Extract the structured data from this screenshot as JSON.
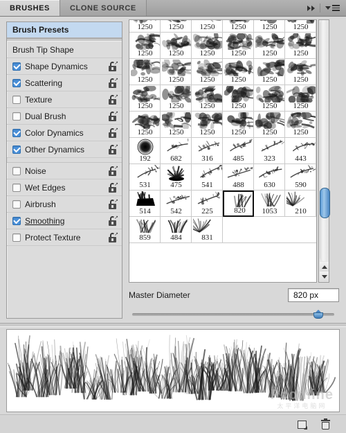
{
  "header": {
    "tabs": [
      {
        "label": "BRUSHES",
        "active": true
      },
      {
        "label": "CLONE SOURCE",
        "active": false
      }
    ],
    "collapse_icon": "double-chevron-right-icon",
    "menu_icon": "panel-menu-icon"
  },
  "sidebar": {
    "preset_label": "Brush Presets",
    "tip_shape_label": "Brush Tip Shape",
    "group1": [
      {
        "label": "Shape Dynamics",
        "checked": true,
        "lock": "lock-open-icon"
      },
      {
        "label": "Scattering",
        "checked": true,
        "lock": "lock-open-icon"
      },
      {
        "label": "Texture",
        "checked": false,
        "lock": "lock-open-icon"
      },
      {
        "label": "Dual Brush",
        "checked": false,
        "lock": "lock-open-icon"
      },
      {
        "label": "Color Dynamics",
        "checked": true,
        "lock": "lock-open-icon"
      },
      {
        "label": "Other Dynamics",
        "checked": true,
        "lock": "lock-open-icon"
      }
    ],
    "group2": [
      {
        "label": "Noise",
        "checked": false,
        "lock": "lock-open-icon"
      },
      {
        "label": "Wet Edges",
        "checked": false,
        "lock": "lock-open-icon"
      },
      {
        "label": "Airbrush",
        "checked": false,
        "lock": "lock-open-icon"
      },
      {
        "label": "Smoothing",
        "checked": true,
        "lock": "lock-open-icon"
      },
      {
        "label": "Protect Texture",
        "checked": false,
        "lock": "lock-open-icon"
      }
    ]
  },
  "brush_grid": {
    "columns": 6,
    "selected_size": "820",
    "cells": [
      {
        "size": "1250",
        "shape": "smoke",
        "partial": true
      },
      {
        "size": "1250",
        "shape": "smoke",
        "partial": true
      },
      {
        "size": "1250",
        "shape": "smoke",
        "partial": true
      },
      {
        "size": "1250",
        "shape": "smoke",
        "partial": true
      },
      {
        "size": "1250",
        "shape": "smoke",
        "partial": true
      },
      {
        "size": "1250",
        "shape": "smoke",
        "partial": true
      },
      {
        "size": "1250",
        "shape": "smoke"
      },
      {
        "size": "1250",
        "shape": "smoke"
      },
      {
        "size": "1250",
        "shape": "smoke"
      },
      {
        "size": "1250",
        "shape": "smoke"
      },
      {
        "size": "1250",
        "shape": "smoke"
      },
      {
        "size": "1250",
        "shape": "smoke"
      },
      {
        "size": "1250",
        "shape": "smoke"
      },
      {
        "size": "1250",
        "shape": "smoke"
      },
      {
        "size": "1250",
        "shape": "smoke"
      },
      {
        "size": "1250",
        "shape": "smoke"
      },
      {
        "size": "1250",
        "shape": "smoke"
      },
      {
        "size": "1250",
        "shape": "smoke"
      },
      {
        "size": "1250",
        "shape": "smoke"
      },
      {
        "size": "1250",
        "shape": "smoke"
      },
      {
        "size": "1250",
        "shape": "smoke"
      },
      {
        "size": "1250",
        "shape": "smoke"
      },
      {
        "size": "1250",
        "shape": "smoke"
      },
      {
        "size": "1250",
        "shape": "smoke"
      },
      {
        "size": "1250",
        "shape": "smoke"
      },
      {
        "size": "1250",
        "shape": "smoke"
      },
      {
        "size": "1250",
        "shape": "smoke"
      },
      {
        "size": "1250",
        "shape": "smoke"
      },
      {
        "size": "1250",
        "shape": "smoke"
      },
      {
        "size": "1250",
        "shape": "smoke"
      },
      {
        "size": "192",
        "shape": "soft-round"
      },
      {
        "size": "682",
        "shape": "branch"
      },
      {
        "size": "316",
        "shape": "branch"
      },
      {
        "size": "485",
        "shape": "branch"
      },
      {
        "size": "323",
        "shape": "branch"
      },
      {
        "size": "443",
        "shape": "branch"
      },
      {
        "size": "531",
        "shape": "branch"
      },
      {
        "size": "475",
        "shape": "burst"
      },
      {
        "size": "541",
        "shape": "branch"
      },
      {
        "size": "488",
        "shape": "branch"
      },
      {
        "size": "630",
        "shape": "branch"
      },
      {
        "size": "590",
        "shape": "branch"
      },
      {
        "size": "514",
        "shape": "bush-solid"
      },
      {
        "size": "542",
        "shape": "branch"
      },
      {
        "size": "225",
        "shape": "branch"
      },
      {
        "size": "820",
        "shape": "grass",
        "selected": true
      },
      {
        "size": "1053",
        "shape": "grass"
      },
      {
        "size": "210",
        "shape": "grass-fan"
      },
      {
        "size": "859",
        "shape": "grass"
      },
      {
        "size": "484",
        "shape": "grass"
      },
      {
        "size": "831",
        "shape": "grass-fan"
      },
      {
        "size": "",
        "shape": "",
        "blank": true
      },
      {
        "size": "",
        "shape": "",
        "blank": true
      },
      {
        "size": "",
        "shape": "",
        "blank": true
      }
    ],
    "scrollbar": {
      "thumb_position_pct": 78
    }
  },
  "master_diameter": {
    "label": "Master Diameter",
    "value": "820 px",
    "slider_pct": 92
  },
  "preview": {
    "stroke_description": "grass-brush-stroke",
    "watermark_line1": "Pconline",
    "watermark_line2": "太平洋电脑网"
  },
  "footer": {
    "new_brush_icon": "new-brush-icon",
    "delete_brush_icon": "delete-brush-icon"
  },
  "colors": {
    "panel_bg": "#d8d8d8",
    "highlight": "#c3d9f0",
    "check_blue": "#4a90d9",
    "slider_blue": "#4a86c4"
  }
}
